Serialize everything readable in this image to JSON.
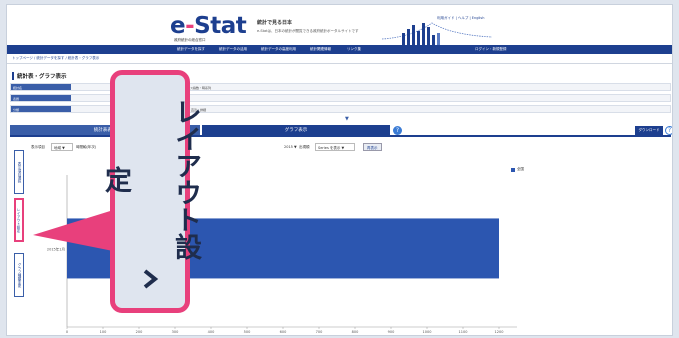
{
  "header": {
    "logo_main": "e",
    "logo_dash": "-",
    "logo_tail": "Stat",
    "logo_sub": "政府統計の総合窓口",
    "tagline": "統計で見る日本",
    "tagline2": "e-Statは、日本の統計が閲覧できる政府統計ポータルサイトです",
    "top_links": "利用ガイド  |  ヘルプ  |  English"
  },
  "nav": {
    "items": [
      "統計データを探す",
      "統計データの活用",
      "統計データの高度利用",
      "統計関連情報",
      "リンク集"
    ],
    "right": "ログイン・新規登録"
  },
  "breadcrumb": "トップページ  /  統計データを探す  /  統計表・グラフ表示",
  "page_title": "統計表・グラフ表示",
  "info_rows": [
    {
      "label": "統計名",
      "value": "ラスパイレス指数・時系列"
    },
    {
      "label": "表題",
      "value": ""
    },
    {
      "label": "分類",
      "value": "月次・年次  直近・詳細"
    }
  ],
  "tabs": {
    "table": "統計表表示",
    "graph": "グラフ表示",
    "download": "ダウンロード"
  },
  "side_tabs": {
    "item1": "表示項目選択",
    "item2": "レイアウト設定",
    "item3": "グラフ種類変更"
  },
  "controls": {
    "label1": "表示項目",
    "select1": "地域 ▼",
    "label2": "時間軸(年次)",
    "select2": "2015 ▼",
    "label3": "出現順",
    "select3": "Series を表示 ▼",
    "button": "再表示"
  },
  "callout": {
    "text": "レイアウト設定",
    "chevron": "chevron-right-icon"
  },
  "colors": {
    "brand": "#1d3f8f",
    "accent": "#e8407c",
    "bar": "#2c56b0"
  },
  "chart_data": {
    "type": "bar",
    "orientation": "horizontal",
    "categories": [
      "2015年1月"
    ],
    "series": [
      {
        "name": "全国",
        "values": [
          1200
        ]
      }
    ],
    "xlim": [
      0,
      1250
    ],
    "xticks": [
      0,
      100,
      200,
      300,
      400,
      500,
      600,
      700,
      800,
      900,
      1000,
      1100,
      1200
    ],
    "legend": "top-right"
  }
}
